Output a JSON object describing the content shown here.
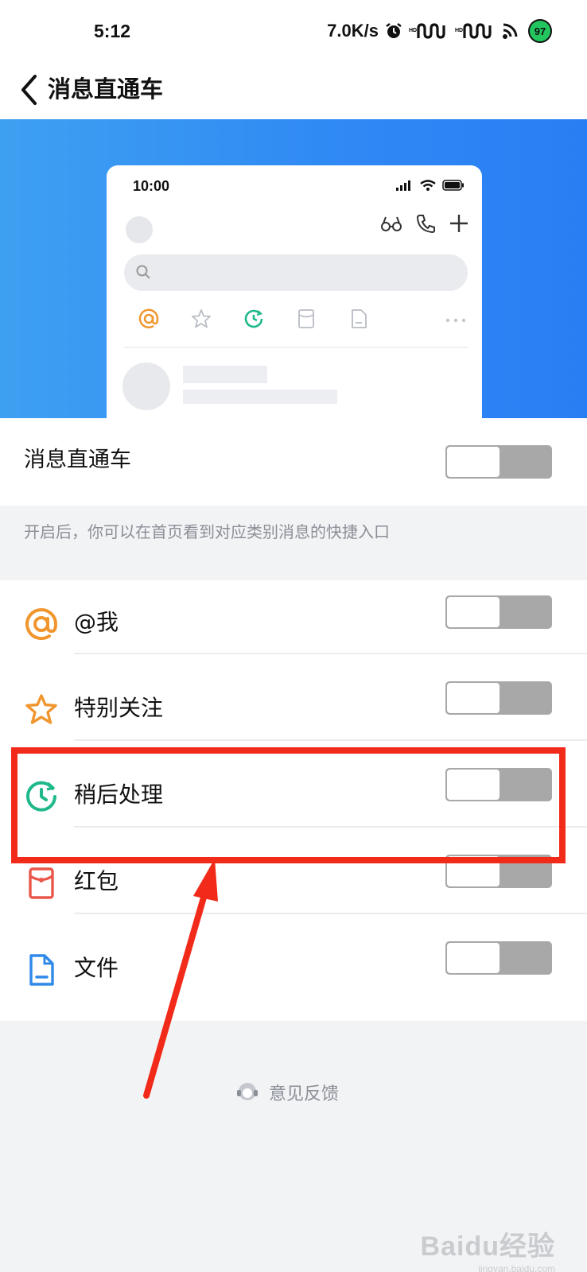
{
  "status_bar": {
    "time": "5:12",
    "net_speed": "7.0K/s",
    "battery": "97",
    "icons": [
      "alarm-icon",
      "signal-icon",
      "signal-icon",
      "wifi-icon",
      "battery-icon"
    ]
  },
  "nav": {
    "back_icon": "chevron-left-icon",
    "title": "消息直通车"
  },
  "preview": {
    "time": "10:00",
    "action_icons": [
      "glasses-icon",
      "phone-icon",
      "plus-icon"
    ],
    "tab_icons": [
      "at-icon",
      "star-icon",
      "clock-icon",
      "red-packet-icon",
      "file-icon",
      "more-icon"
    ]
  },
  "main_toggle": {
    "label": "消息直通车",
    "on": false
  },
  "hint": "开启后，你可以在首页看到对应类别消息的快捷入口",
  "items": [
    {
      "label": "@我",
      "icon": "at-icon",
      "color": "#f0962e",
      "on": false
    },
    {
      "label": "特别关注",
      "icon": "star-icon",
      "color": "#f0962e",
      "on": false
    },
    {
      "label": "稍后处理",
      "icon": "clock-icon",
      "color": "#1fb88a",
      "on": false
    },
    {
      "label": "红包",
      "icon": "red-packet-icon",
      "color": "#e9574a",
      "on": false
    },
    {
      "label": "文件",
      "icon": "file-icon",
      "color": "#2f8ae8",
      "on": false
    }
  ],
  "feedback": {
    "label": "意见反馈",
    "icon": "headset-icon"
  },
  "watermark": {
    "main": "Baidu经验",
    "sub": "jingyan.baidu.com"
  },
  "colors": {
    "hero_gradient_start": "#3ea0f1",
    "hero_gradient_end": "#2a7ef3",
    "toggle_off": "#a8a8a8",
    "annotation": "#f22a1a",
    "hint_text": "#8b8f96"
  }
}
